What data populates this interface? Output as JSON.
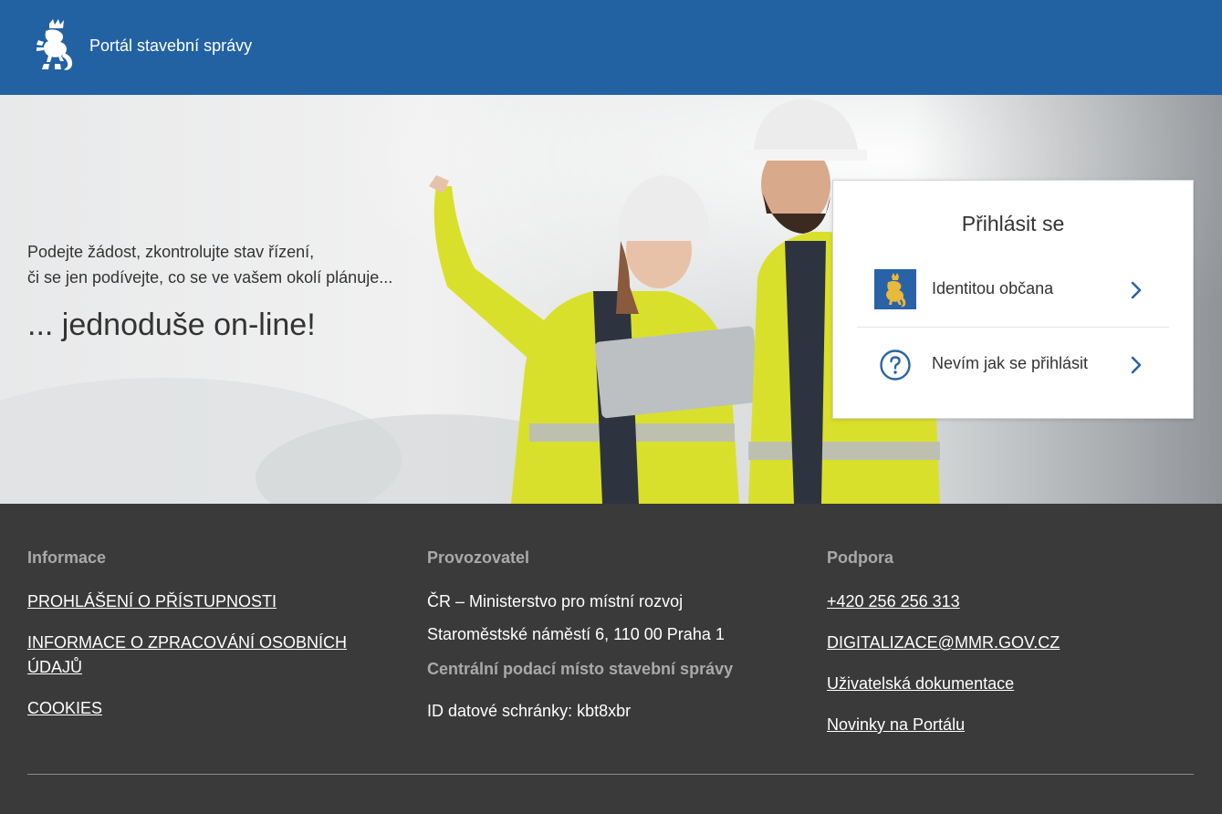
{
  "header": {
    "title": "Portál stavební správy",
    "background_color": "#2362a2",
    "logo_icon": "czech-lion-icon"
  },
  "hero": {
    "line1": "Podejte žádost, zkontrolujte stav řízení,",
    "line2": "či se jen podívejte, co se ve vašem okolí plánuje...",
    "slogan": "... jednoduše on-line!",
    "image_subject": "construction-workers-with-tablet"
  },
  "login": {
    "title": "Přihlásit se",
    "options": [
      {
        "label": "Identitou občana",
        "icon": "czech-lion-icon"
      },
      {
        "label": "Nevím jak se přihlásit",
        "icon": "question-circle-icon"
      }
    ],
    "accent_color": "#2a62a8"
  },
  "footer": {
    "background_color": "#3a3a3a",
    "informace": {
      "heading": "Informace",
      "links": [
        "PROHLÁŠENÍ O PŘÍSTUPNOSTI",
        "INFORMACE O ZPRACOVÁNÍ OSOBNÍCH ÚDAJŮ",
        "COOKIES"
      ]
    },
    "provozovatel": {
      "heading": "Provozovatel",
      "lines": [
        "ČR – Ministerstvo pro místní rozvoj",
        "Staroměstské náměstí 6, 110 00 Praha 1"
      ],
      "subheading": "Centrální podací místo stavební správy",
      "databox": "ID datové schránky: kbt8xbr"
    },
    "podpora": {
      "heading": "Podpora",
      "links": [
        "+420 256 256 313",
        "DIGITALIZACE@MMR.GOV.CZ",
        "Uživatelská dokumentace",
        "Novinky na Portálu"
      ]
    }
  }
}
